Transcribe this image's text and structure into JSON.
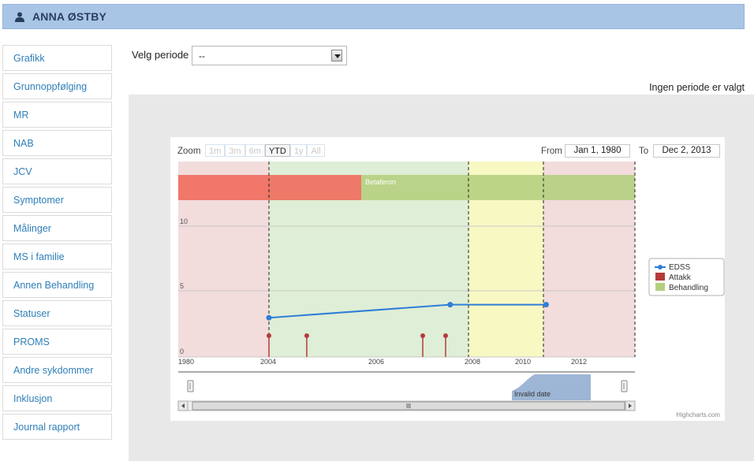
{
  "header": {
    "title": "ANNA ØSTBY",
    "icon": "user-icon"
  },
  "sidebar": {
    "items": [
      {
        "label": "Grafikk"
      },
      {
        "label": "Grunnoppfølging"
      },
      {
        "label": "MR"
      },
      {
        "label": "NAB"
      },
      {
        "label": "JCV"
      },
      {
        "label": "Symptomer"
      },
      {
        "label": "Målinger"
      },
      {
        "label": "MS i familie"
      },
      {
        "label": "Annen Behandling"
      },
      {
        "label": "Statuser"
      },
      {
        "label": "PROMS"
      },
      {
        "label": "Andre sykdommer"
      },
      {
        "label": "Inklusjon"
      },
      {
        "label": "Journal rapport"
      }
    ]
  },
  "period": {
    "label": "Velg periode",
    "selected": "--",
    "status": "Ingen periode er valgt"
  },
  "chart": {
    "zoom_label": "Zoom",
    "zoom_buttons": [
      "1m",
      "3m",
      "6m",
      "YTD",
      "1y",
      "All"
    ],
    "zoom_active": "YTD",
    "from_label": "From",
    "from_value": "Jan 1, 1980",
    "to_label": "To",
    "to_value": "Dec 2, 2013",
    "credits": "Highcharts.com",
    "navigator_label": "Invalid date",
    "colors": {
      "edss": "#2f7ed8",
      "attakk": "#b53a3a",
      "behandling": "#b5cf7f",
      "bg_pink": "#f2dcdc",
      "bg_green": "#dfeed6",
      "bg_yellow": "#f8f8c3",
      "red_bar": "#ef6b5c"
    }
  },
  "chart_data": {
    "type": "line",
    "x_ticks": [
      "1980",
      "2004",
      "2006",
      "2008",
      "2010",
      "2012"
    ],
    "y_ticks": [
      0,
      5,
      10
    ],
    "ylim": [
      0,
      10
    ],
    "legend": [
      "EDSS",
      "Attakk",
      "Behandling"
    ],
    "legend_position": "right",
    "series": [
      {
        "name": "EDSS",
        "type": "line",
        "x": [
          2004.0,
          2007.6,
          2010.8
        ],
        "y": [
          3,
          4,
          4
        ]
      },
      {
        "name": "Attakk",
        "type": "stem",
        "x": [
          2004.0,
          2004.7,
          2007.0,
          2007.5
        ],
        "y": [
          1,
          1,
          1,
          1
        ]
      }
    ],
    "treatment_band": {
      "label": "Betaferon"
    }
  }
}
